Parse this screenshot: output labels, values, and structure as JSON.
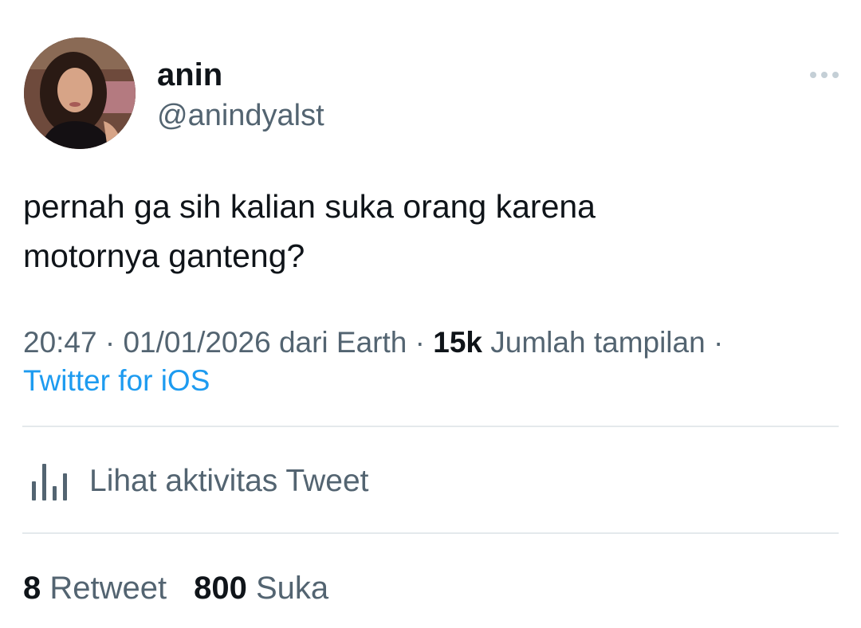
{
  "tweet": {
    "author": {
      "display_name": "anin",
      "handle": "@anindyalst",
      "avatar": "profile-photo"
    },
    "more_icon": "more-horizontal-icon",
    "text_line1": "pernah ga sih kalian suka orang karena",
    "text_line2": "motornya ganteng?",
    "meta": {
      "time": "20:47",
      "date": "01/01/2026",
      "location": "dari Earth",
      "views_count": "15k",
      "views_label": "Jumlah tampilan",
      "separator": "·",
      "source": "Twitter for iOS"
    },
    "activity": {
      "icon": "analytics-bar-icon",
      "label": "Lihat aktivitas Tweet"
    },
    "stats": {
      "retweets_count": "8",
      "retweets_label": "Retweet",
      "likes_count": "800",
      "likes_label": "Suka"
    }
  },
  "colors": {
    "text_primary": "#0f1419",
    "text_secondary": "#536471",
    "link": "#1d9bf0",
    "divider": "#e4e9ec"
  }
}
